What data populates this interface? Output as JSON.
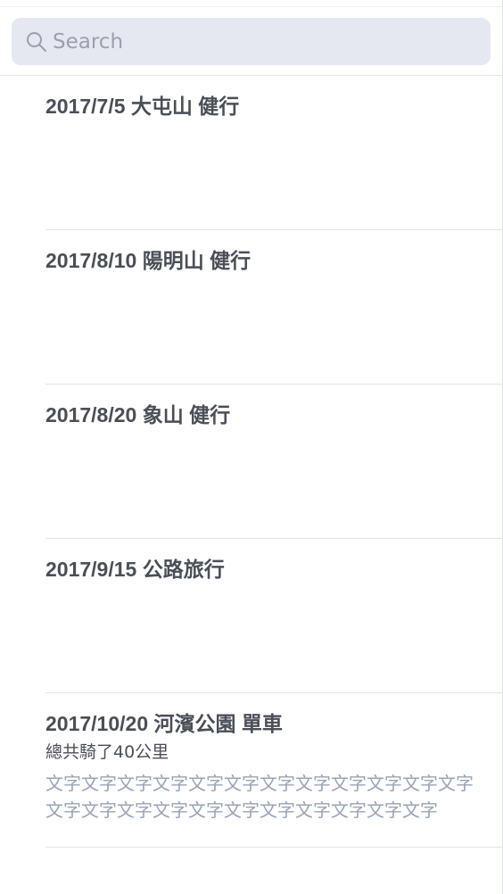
{
  "search": {
    "placeholder": "Search",
    "icon": "search-icon"
  },
  "entries": [
    {
      "title": "2017/7/5 大屯山 健行"
    },
    {
      "title": "2017/8/10 陽明山 健行"
    },
    {
      "title": "2017/8/20 象山 健行"
    },
    {
      "title": "2017/9/15 公路旅行"
    },
    {
      "title": "2017/10/20 河濱公園 單車",
      "subtitle": "總共騎了40公里",
      "body": "文字文字文字文字文字文字文字文字文字文字文字文字文字文字文字文字文字文字文字文字文字文字文字"
    }
  ],
  "colors": {
    "search_background": "#e6e8f1",
    "placeholder": "#9aa0ad",
    "title": "#4a4f57",
    "body_text": "#9aa3b5",
    "divider": "#e2e4e8"
  }
}
